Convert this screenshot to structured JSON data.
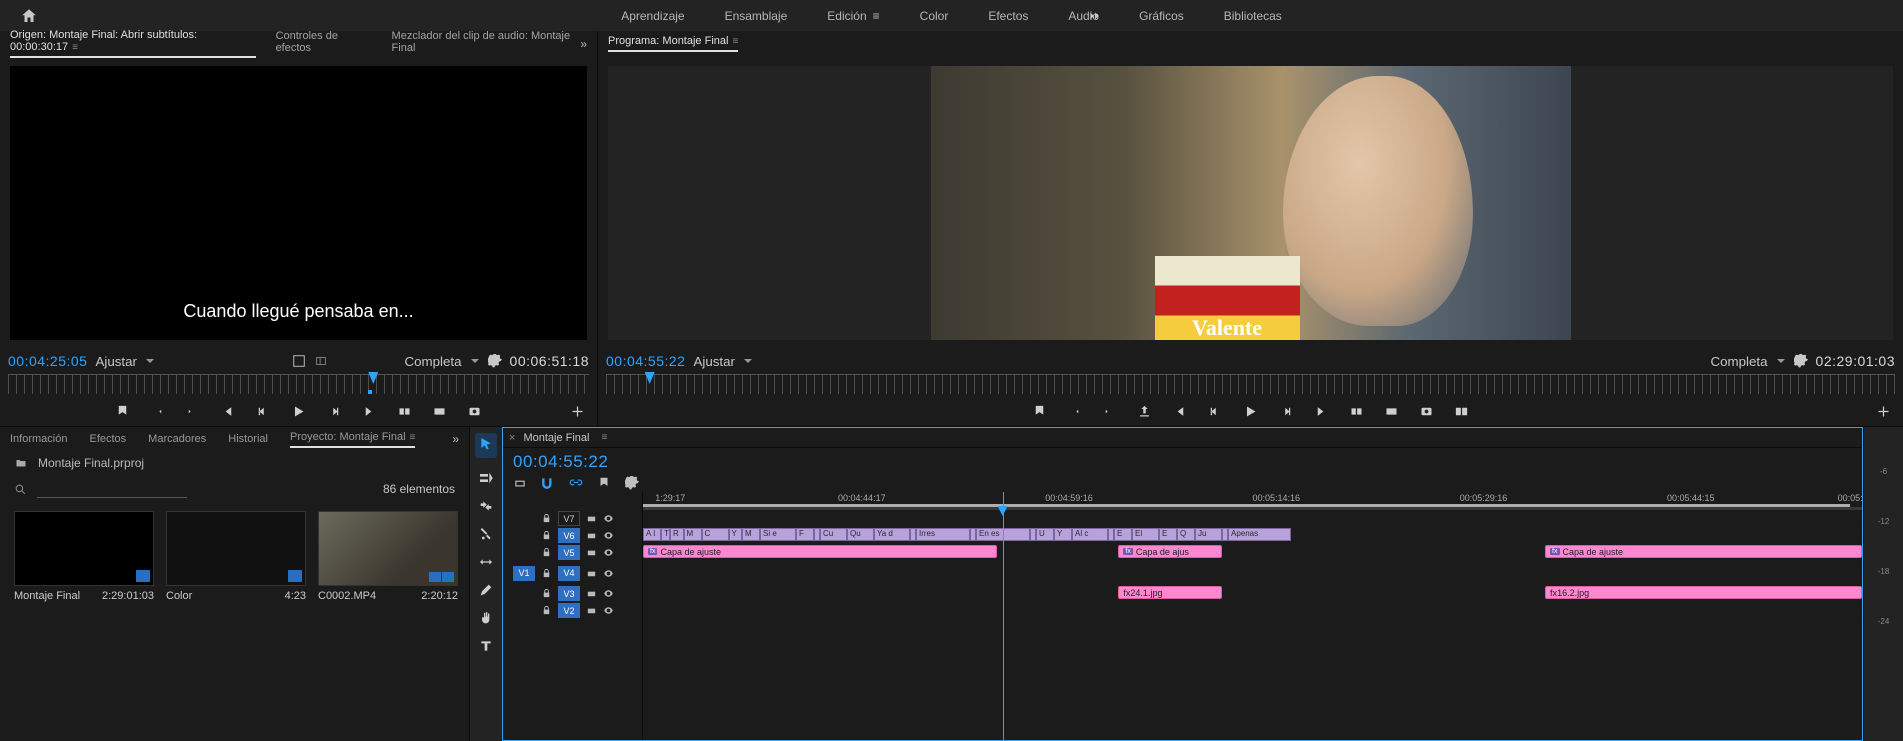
{
  "workspaces": {
    "items": [
      "Aprendizaje",
      "Ensamblaje",
      "Edición",
      "Color",
      "Efectos",
      "Audio",
      "Gráficos",
      "Bibliotecas"
    ],
    "active": "Edición"
  },
  "source": {
    "tab_main": "Origen: Montaje Final: Abrir subtítulos: 00:00:30:17",
    "tab_effects": "Controles de efectos",
    "tab_mixer": "Mezclador del clip de audio: Montaje Final",
    "tc_left": "00:04:25:05",
    "fit": "Ajustar",
    "quality": "Completa",
    "tc_right": "00:06:51:18",
    "subtitle_text": "Cuando llegué pensaba en..."
  },
  "program": {
    "tab": "Programa: Montaje Final",
    "tc_left": "00:04:55:22",
    "fit": "Ajustar",
    "quality": "Completa",
    "tc_right": "02:29:01:03",
    "brand_in_shot": "Valente"
  },
  "project": {
    "tabs": {
      "info": "Información",
      "effects": "Efectos",
      "markers": "Marcadores",
      "history": "Historial",
      "project": "Proyecto: Montaje Final"
    },
    "filename": "Montaje Final.prproj",
    "count": "86 elementos",
    "bins": [
      {
        "name": "Montaje Final",
        "dur": "2:29:01:03",
        "kind": "sequence"
      },
      {
        "name": "Color",
        "dur": "4:23",
        "kind": "color"
      },
      {
        "name": "C0002.MP4",
        "dur": "2:20:12",
        "kind": "video"
      }
    ]
  },
  "timeline": {
    "tab_name": "Montaje Final",
    "tc": "00:04:55:22",
    "ruler_marks": [
      "1:29:17",
      "00:04:44:17",
      "00:04:59:16",
      "00:05:14:16",
      "00:05:29:16",
      "00:05:44:15",
      "00:05:"
    ],
    "tracks": {
      "v7": "V7",
      "v6": "V6",
      "v5": "V5",
      "v4": "V4",
      "v3": "V3",
      "v2": "V2",
      "v1": "V1"
    },
    "subtitle_segs": [
      "A I",
      "T",
      "R",
      "M",
      "C",
      "Y",
      "M",
      "Si e",
      "F",
      "",
      "Cu",
      "Qu",
      "Ya d",
      "",
      "Irres",
      "",
      "En es",
      "",
      "U",
      "Y",
      "Al c",
      "",
      "E",
      "El",
      "E",
      "Q",
      "Ju",
      "",
      "Apenas"
    ],
    "adjust1": "Capa de ajuste",
    "adjust2": "Capa de ajus",
    "adjust3": "Capa de ajuste",
    "img1": "24.1.jpg",
    "img2": "16.2.jpg",
    "fx": "fx"
  },
  "meters": {
    "marks": [
      "-6",
      "-12",
      "-18",
      "-24"
    ]
  }
}
